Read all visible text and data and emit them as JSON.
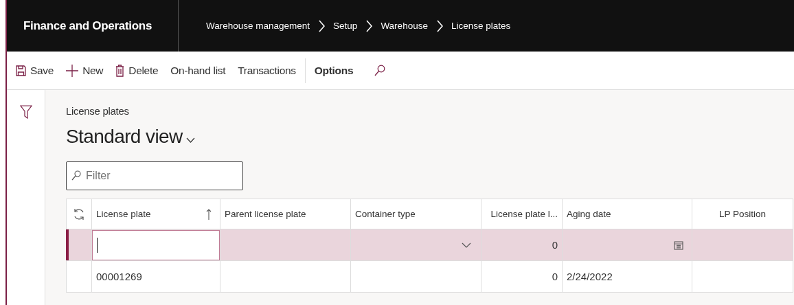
{
  "app_title": "Finance and Operations",
  "breadcrumb": [
    "Warehouse management",
    "Setup",
    "Warehouse",
    "License plates"
  ],
  "toolbar": [
    {
      "label": "Save",
      "kind": "save",
      "selected": false
    },
    {
      "label": "New",
      "kind": "new",
      "selected": false
    },
    {
      "label": "Delete",
      "kind": "delete",
      "selected": false
    },
    {
      "label": "On-hand list",
      "kind": "text",
      "selected": false
    },
    {
      "label": "Transactions",
      "kind": "text",
      "selected": false
    },
    {
      "label": "Options",
      "kind": "text",
      "selected": true
    }
  ],
  "page_caption": "License plates",
  "view_title": "Standard view",
  "filter": {
    "placeholder": "Filter"
  },
  "table": {
    "columns": [
      {
        "label": "License plate",
        "kind": "sorted"
      },
      {
        "label": "Parent license plate",
        "kind": "text"
      },
      {
        "label": "Container type",
        "kind": "dropdown"
      },
      {
        "label": "License plate l...",
        "kind": "number"
      },
      {
        "label": "Aging date",
        "kind": "date"
      },
      {
        "label": "LP Position",
        "kind": "centered"
      }
    ],
    "rows": [
      {
        "selected": true,
        "license_plate_level": "0"
      },
      {
        "selected": false,
        "license_plate": "00001269",
        "license_plate_level": "0",
        "aging_date": "2/24/2022"
      }
    ]
  }
}
